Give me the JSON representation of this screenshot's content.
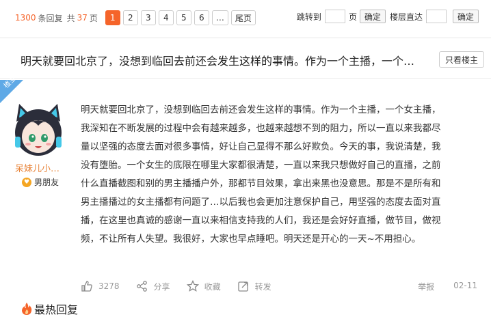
{
  "pager": {
    "count": "1300",
    "count_label": "条回复",
    "total_prefix": "共",
    "total_pages": "37",
    "total_suffix": "页",
    "pages": [
      "1",
      "2",
      "3",
      "4",
      "5",
      "6",
      "…",
      "尾页"
    ],
    "active_page": "1",
    "jump_label": "跳转到",
    "jump_unit": "页",
    "confirm_label": "确定",
    "floor_label": "楼层直达",
    "floor_confirm_label": "确定"
  },
  "thread": {
    "title": "明天就要回北京了，没想到临回去前还会发生这样的事情。作为一个主播，一个…",
    "only_op_label": "只看楼主"
  },
  "post": {
    "badge": "楼主",
    "author_name": "呆妹儿小…",
    "author_tag": "男朋友",
    "lines": [
      "明天就要回北京了，没想到临回去前还会发生这样的事情。作为一个主播，一个女主播，",
      "我深知在不断发展的过程中会有越来越多，也越来越想不到的阻力，所以一直以来我都尽",
      "量以坚强的态度去面对很多事情，好让自己显得不那么好欺负。今天的事，我说清楚，我",
      "没有堕胎。一个女生的底限在哪里大家都很清楚，一直以来我只想做好自己的直播，之前",
      "什么直播截图和别的男主播播户外，那都节目效果，拿出来黑也没意思。那是不是所有和",
      "男主播播过的女主播都有问题了…以后我也会更加注意保护自己，用坚强的态度去面对直",
      "播，在这里也真诚的感谢一直以来相信支持我的人们，我还是会好好直播，做节目，做视",
      "频，不让所有人失望。我很好，大家也早点睡吧。明天还是开心的一天~不用担心。"
    ],
    "likes": "3278",
    "share_label": "分享",
    "collect_label": "收藏",
    "repost_label": "转发",
    "report_label": "举报",
    "date": "02-11"
  },
  "hot_replies_label": "最热回复",
  "colors": {
    "accent": "#f5642a",
    "badge_blue": "#5fa9e6",
    "author_name": "#e8843a"
  }
}
